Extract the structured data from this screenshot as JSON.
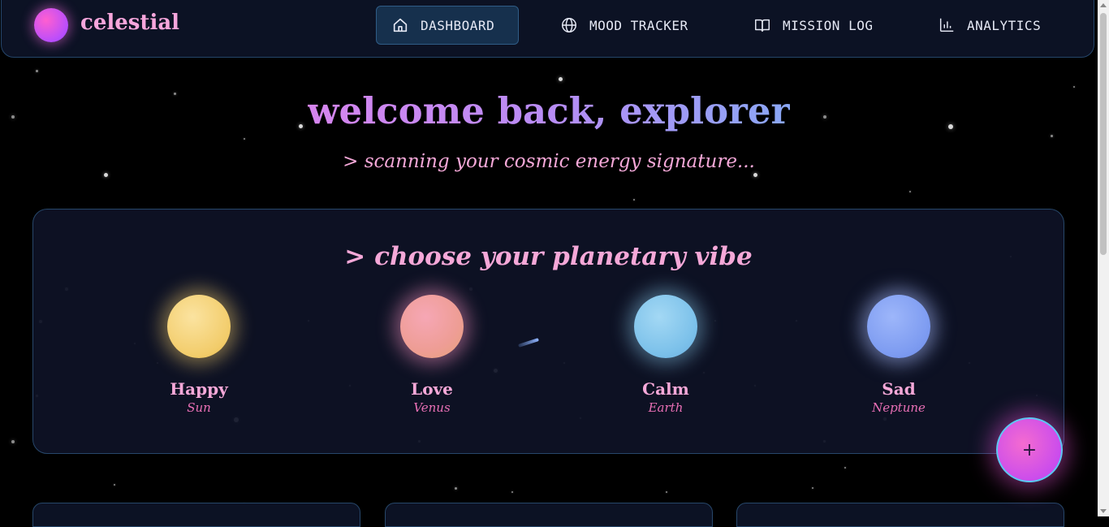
{
  "brand": {
    "name": "celestial"
  },
  "nav": {
    "items": [
      {
        "label": "DASHBOARD",
        "icon": "home-icon",
        "active": true
      },
      {
        "label": "MOOD TRACKER",
        "icon": "globe-icon",
        "active": false
      },
      {
        "label": "MISSION LOG",
        "icon": "book-icon",
        "active": false
      },
      {
        "label": "ANALYTICS",
        "icon": "bar-chart-icon",
        "active": false
      }
    ]
  },
  "hero": {
    "title": "welcome back, explorer",
    "subtitle": "> scanning your cosmic energy signature..."
  },
  "vibe": {
    "title": "> choose your planetary vibe",
    "planets": [
      {
        "mood": "Happy",
        "body": "Sun",
        "color": "#f2cc6a"
      },
      {
        "mood": "Love",
        "body": "Venus",
        "color": "#ee9d95"
      },
      {
        "mood": "Calm",
        "body": "Earth",
        "color": "#7cc1ea"
      },
      {
        "mood": "Sad",
        "body": "Neptune",
        "color": "#7e9cf1"
      }
    ]
  },
  "fab": {
    "label": "+"
  },
  "colors": {
    "accent_pink": "#f5a8d8",
    "nav_bg": "#0c1224",
    "border": "#27476a"
  }
}
